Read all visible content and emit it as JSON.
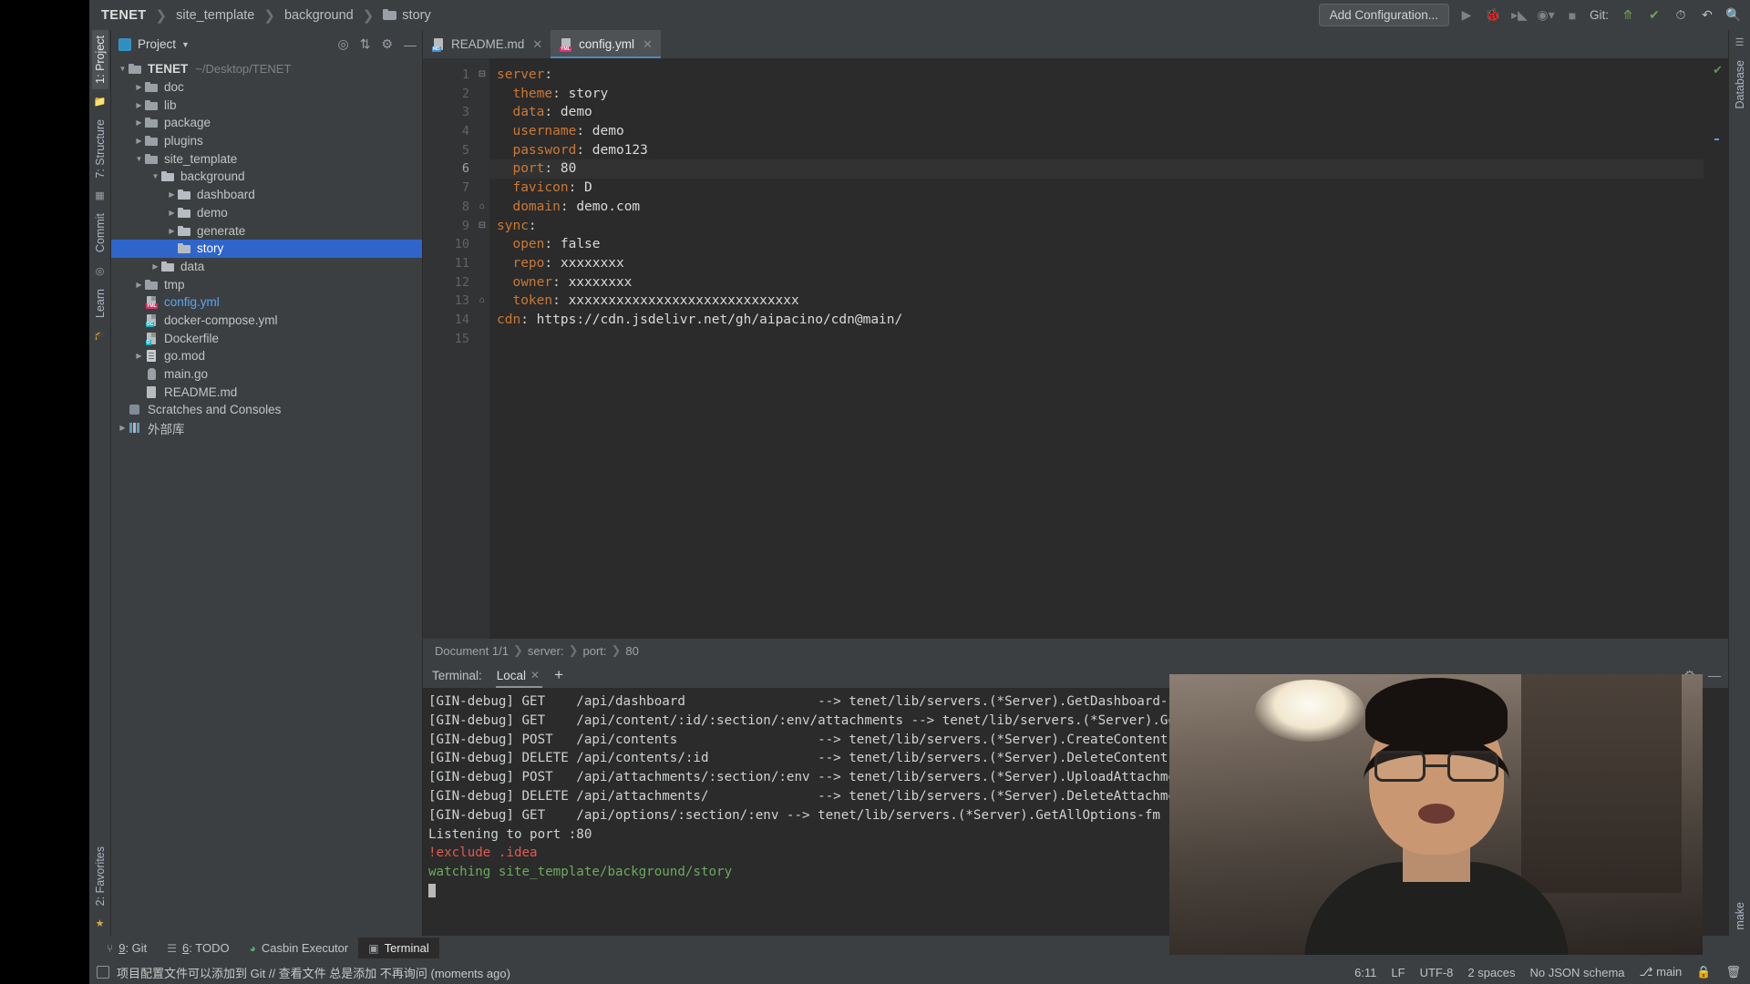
{
  "titlebar": {
    "breadcrumbs": [
      {
        "label": "TENET",
        "bold": true,
        "icon": "none"
      },
      {
        "label": "site_template",
        "bold": false,
        "icon": "none"
      },
      {
        "label": "background",
        "bold": false,
        "icon": "none"
      },
      {
        "label": "story",
        "bold": false,
        "icon": "folder-icon"
      }
    ],
    "add_configuration": "Add Configuration...",
    "git_label": "Git:",
    "icons": [
      "run-icon",
      "debug-icon",
      "coverage-icon",
      "profiler-icon",
      "stop-icon",
      "git-update-icon",
      "git-commit-check-icon",
      "history-icon",
      "undo-icon",
      "search-icon"
    ]
  },
  "left_stripe": {
    "tabs": [
      "1: Project",
      "7: Structure",
      "Commit",
      "Learn",
      "2: Favorites"
    ]
  },
  "right_stripe": {
    "tabs": [
      "Database",
      "make"
    ]
  },
  "project_panel": {
    "title": "Project",
    "actions": [
      "locate-icon",
      "collapse-all-icon",
      "settings-icon",
      "minimize-icon"
    ],
    "tree": [
      {
        "indent": 0,
        "twisty": "down",
        "icon": "folder",
        "name": "TENET",
        "bold": true,
        "path": "~/Desktop/TENET"
      },
      {
        "indent": 1,
        "twisty": "right",
        "icon": "folder",
        "name": "doc"
      },
      {
        "indent": 1,
        "twisty": "right",
        "icon": "folder",
        "name": "lib"
      },
      {
        "indent": 1,
        "twisty": "right",
        "icon": "folder",
        "name": "package"
      },
      {
        "indent": 1,
        "twisty": "right",
        "icon": "folder",
        "name": "plugins"
      },
      {
        "indent": 1,
        "twisty": "down",
        "icon": "folder",
        "name": "site_template"
      },
      {
        "indent": 2,
        "twisty": "down",
        "icon": "folderlt",
        "name": "background"
      },
      {
        "indent": 3,
        "twisty": "right",
        "icon": "folderlt",
        "name": "dashboard"
      },
      {
        "indent": 3,
        "twisty": "right",
        "icon": "folderlt",
        "name": "demo"
      },
      {
        "indent": 3,
        "twisty": "right",
        "icon": "folderlt",
        "name": "generate"
      },
      {
        "indent": 3,
        "twisty": "none",
        "icon": "folderlt",
        "name": "story",
        "selected": true
      },
      {
        "indent": 2,
        "twisty": "right",
        "icon": "folderlt",
        "name": "data"
      },
      {
        "indent": 1,
        "twisty": "right",
        "icon": "folder",
        "name": "tmp"
      },
      {
        "indent": 1,
        "twisty": "none",
        "icon": "yml",
        "name": "config.yml",
        "color": "cyan"
      },
      {
        "indent": 1,
        "twisty": "none",
        "icon": "dc",
        "name": "docker-compose.yml"
      },
      {
        "indent": 1,
        "twisty": "none",
        "icon": "d",
        "name": "Dockerfile"
      },
      {
        "indent": 1,
        "twisty": "right",
        "icon": "go",
        "name": "go.mod"
      },
      {
        "indent": 1,
        "twisty": "none",
        "icon": "gopher",
        "name": "main.go"
      },
      {
        "indent": 1,
        "twisty": "none",
        "icon": "md",
        "name": "README.md"
      },
      {
        "indent": 0,
        "twisty": "none",
        "icon": "scr",
        "name": "Scratches and Consoles"
      },
      {
        "indent": 0,
        "twisty": "right",
        "icon": "lib",
        "name": "外部库"
      }
    ]
  },
  "editor": {
    "tabs": [
      {
        "label": "README.md",
        "badge": "MD",
        "badge_color": "#3f8fd0",
        "active": false
      },
      {
        "label": "config.yml",
        "badge": "YML",
        "badge_color": "#d6336c",
        "active": true
      }
    ],
    "lines": [
      {
        "n": 1,
        "fold": "minus",
        "indent": 0,
        "key": "server",
        "sep": ":",
        "value": "",
        "highlight": false
      },
      {
        "n": 2,
        "fold": "",
        "indent": 1,
        "key": "theme",
        "sep": ": ",
        "value": "story",
        "highlight": false
      },
      {
        "n": 3,
        "fold": "",
        "indent": 1,
        "key": "data",
        "sep": ": ",
        "value": "demo",
        "highlight": false
      },
      {
        "n": 4,
        "fold": "",
        "indent": 1,
        "key": "username",
        "sep": ": ",
        "value": "demo",
        "highlight": false
      },
      {
        "n": 5,
        "fold": "",
        "indent": 1,
        "key": "password",
        "sep": ": ",
        "value": "demo123",
        "highlight": false
      },
      {
        "n": 6,
        "fold": "",
        "indent": 1,
        "key": "port",
        "sep": ": ",
        "value": "80",
        "highlight": true
      },
      {
        "n": 7,
        "fold": "",
        "indent": 1,
        "key": "favicon",
        "sep": ": ",
        "value": "D",
        "highlight": false
      },
      {
        "n": 8,
        "fold": "end",
        "indent": 1,
        "key": "domain",
        "sep": ": ",
        "value": "demo.com",
        "highlight": false
      },
      {
        "n": 9,
        "fold": "minus",
        "indent": 0,
        "key": "sync",
        "sep": ":",
        "value": "",
        "highlight": false
      },
      {
        "n": 10,
        "fold": "",
        "indent": 1,
        "key": "open",
        "sep": ": ",
        "value": "false",
        "highlight": false
      },
      {
        "n": 11,
        "fold": "",
        "indent": 1,
        "key": "repo",
        "sep": ": ",
        "value": "xxxxxxxx",
        "highlight": false
      },
      {
        "n": 12,
        "fold": "",
        "indent": 1,
        "key": "owner",
        "sep": ": ",
        "value": "xxxxxxxx",
        "highlight": false
      },
      {
        "n": 13,
        "fold": "end",
        "indent": 1,
        "key": "token",
        "sep": ": ",
        "value": "xxxxxxxxxxxxxxxxxxxxxxxxxxxxx",
        "highlight": false
      },
      {
        "n": 14,
        "fold": "",
        "indent": 0,
        "key": "cdn",
        "sep": ": ",
        "value": "https://cdn.jsdelivr.net/gh/aipacino/cdn@main/",
        "highlight": false
      },
      {
        "n": 15,
        "fold": "",
        "indent": 0,
        "key": "",
        "sep": "",
        "value": "",
        "highlight": false
      }
    ],
    "breadcrumb": [
      "Document 1/1",
      "server:",
      "port:",
      "80"
    ]
  },
  "terminal": {
    "label": "Terminal:",
    "tab": "Local",
    "add_tab": "+",
    "actions": [
      "settings-icon",
      "minimize-icon"
    ],
    "output": [
      {
        "text": "[GIN-debug] GET    /api/dashboard                 --> tenet/lib/servers.(*Server).GetDashboard-fm (5 handlers)",
        "color": "default"
      },
      {
        "text": "[GIN-debug] GET    /api/content/:id/:section/:env/attachments --> tenet/lib/servers.(*Server).GetContentAttachments",
        "color": "default"
      },
      {
        "text": "[GIN-debug] POST   /api/contents                  --> tenet/lib/servers.(*Server).CreateContent-fm (4 handlers)",
        "color": "default"
      },
      {
        "text": "[GIN-debug] DELETE /api/contents/:id              --> tenet/lib/servers.(*Server).DeleteContent-fm (4 handlers)",
        "color": "default"
      },
      {
        "text": "[GIN-debug] POST   /api/attachments/:section/:env --> tenet/lib/servers.(*Server).UploadAttachments-fm (4 handlers)",
        "color": "default"
      },
      {
        "text": "[GIN-debug] DELETE /api/attachments/              --> tenet/lib/servers.(*Server).DeleteAttachments-fm (4 handlers)",
        "color": "default"
      },
      {
        "text": "[GIN-debug] GET    /api/options/:section/:env --> tenet/lib/servers.(*Server).GetAllOptions-fm (4 handlers)",
        "color": "default"
      },
      {
        "text": "Listening to port :80",
        "color": "default"
      },
      {
        "text": "!exclude .idea",
        "color": "red"
      },
      {
        "text": "watching site_template/background/story",
        "color": "green"
      }
    ]
  },
  "bottom_tools": [
    {
      "label": "9: Git",
      "underline": "9",
      "icon": "git-branch-icon",
      "active": false
    },
    {
      "label": "6: TODO",
      "underline": "6",
      "icon": "todo-list-icon",
      "active": false
    },
    {
      "label": "Casbin Executor",
      "underline": "",
      "icon": "casbin-icon",
      "active": false
    },
    {
      "label": "Terminal",
      "underline": "",
      "icon": "terminal-icon",
      "active": true
    }
  ],
  "status_bar": {
    "message": "项目配置文件可以添加到 Git // 查看文件  总是添加  不再询问 (moments ago)",
    "caret_position": "6:11",
    "line_separator": "LF",
    "encoding": "UTF-8",
    "indent": "2 spaces",
    "schema": "No JSON schema",
    "branch": "main",
    "lock_icon": "lock-icon",
    "trash_icon": "trash-icon"
  }
}
